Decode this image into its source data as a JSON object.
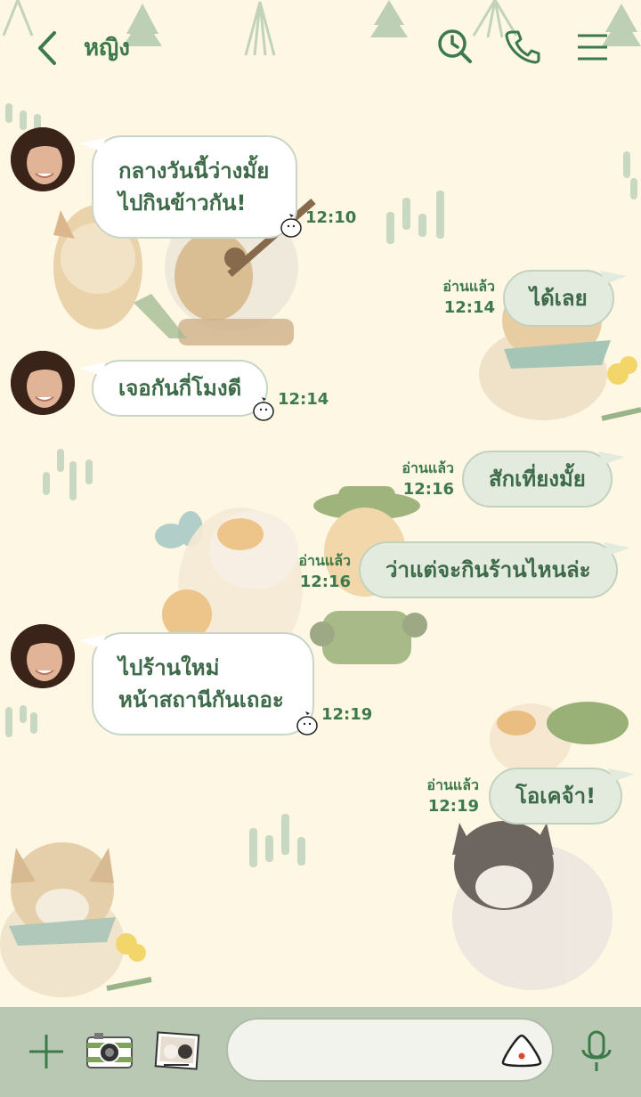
{
  "header": {
    "title": "หญิง"
  },
  "messages": [
    {
      "from": "them",
      "text_lines": [
        "กลางวันนี้ว่างมั้ย",
        "ไปกินข้าวกัน!"
      ],
      "time": "12:10"
    },
    {
      "from": "me",
      "text": "ได้เลย",
      "read_label": "อ่านแล้ว",
      "time": "12:14"
    },
    {
      "from": "them",
      "text_lines": [
        "เจอกันกี่โมงดี"
      ],
      "time": "12:14"
    },
    {
      "from": "me",
      "text": "สักเที่ยงมั้ย",
      "read_label": "อ่านแล้ว",
      "time": "12:16"
    },
    {
      "from": "me",
      "text": "ว่าแต่จะกินร้านไหนล่ะ",
      "read_label": "อ่านแล้ว",
      "time": "12:16"
    },
    {
      "from": "them",
      "text_lines": [
        "ไปร้านใหม่",
        "หน้าสถานีกันเถอะ"
      ],
      "time": "12:19"
    },
    {
      "from": "me",
      "text": "โอเคจ้า!",
      "read_label": "อ่านแล้ว",
      "time": "12:19"
    }
  ],
  "composer": {
    "placeholder": ""
  },
  "icons": {
    "header": [
      "back-arrow-icon",
      "search-history-icon",
      "phone-icon",
      "menu-icon"
    ],
    "bottom": [
      "plus-icon",
      "camera-icon",
      "gallery-icon",
      "sticker-icon",
      "microphone-icon"
    ]
  },
  "colors": {
    "accent": "#3d7a4a",
    "background": "#fdf7e3",
    "bar": "#b9c8b3",
    "bubble_out": "#e3ebde"
  }
}
